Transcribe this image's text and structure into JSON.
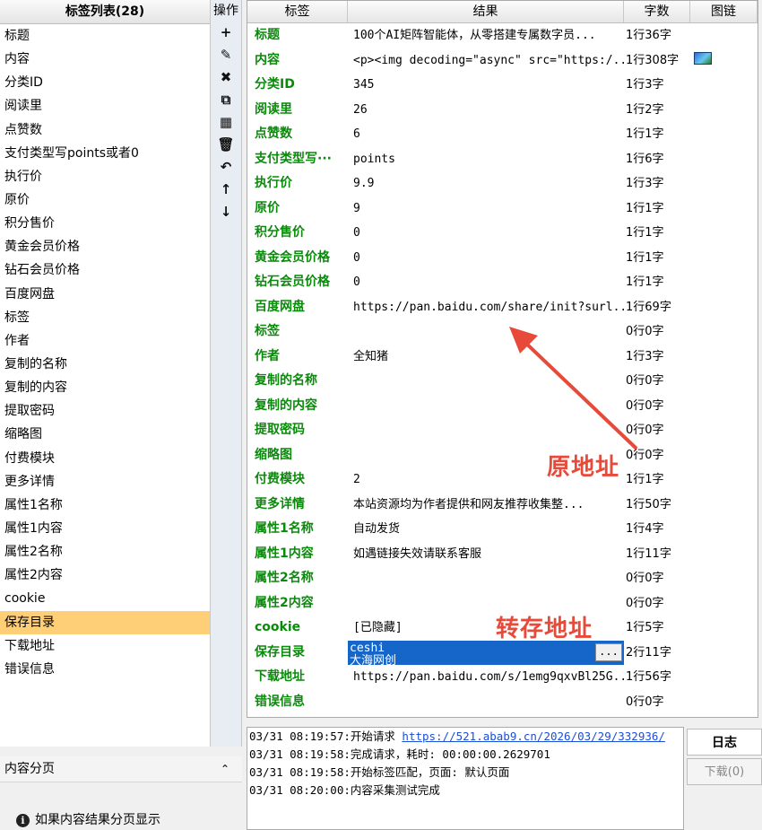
{
  "left_panel": {
    "title": "标签列表(28)",
    "items": [
      "标题",
      "内容",
      "分类ID",
      "阅读里",
      "点赞数",
      "支付类型写points或者0",
      "执行价",
      "原价",
      "积分售价",
      "黄金会员价格",
      "钻石会员价格",
      "百度网盘",
      "标签",
      "作者",
      "复制的名称",
      "复制的内容",
      "提取密码",
      "缩略图",
      "付费模块",
      "更多详情",
      "属性1名称",
      "属性1内容",
      "属性2名称",
      "属性2内容",
      "cookie",
      "保存目录",
      "下载地址",
      "错误信息"
    ],
    "selected_index": 25
  },
  "ops": {
    "title": "操作",
    "buttons": [
      {
        "icon": "plus-icon",
        "glyph": "+"
      },
      {
        "icon": "pencil-icon",
        "glyph": "✎"
      },
      {
        "icon": "close-icon",
        "glyph": "✖"
      },
      {
        "icon": "copy-icon",
        "glyph": "⧉"
      },
      {
        "icon": "paste-icon",
        "glyph": "▦"
      },
      {
        "icon": "trash-icon",
        "glyph": "🗑"
      },
      {
        "icon": "undo-icon",
        "glyph": "↶"
      },
      {
        "icon": "arrow-up-icon",
        "glyph": "↑"
      },
      {
        "icon": "arrow-down-icon",
        "glyph": "↓"
      }
    ]
  },
  "table": {
    "headers": [
      "标签",
      "结果",
      "字数",
      "图链"
    ],
    "rows": [
      {
        "label": "标题",
        "result": "100个AI矩阵智能体，从零搭建专属数字员...",
        "count": "1行36字",
        "img": false
      },
      {
        "label": "内容",
        "result": "<p><img decoding=\"async\" src=\"https:/...",
        "count": "1行308字",
        "img": true
      },
      {
        "label": "分类ID",
        "result": "345",
        "count": "1行3字",
        "img": false
      },
      {
        "label": "阅读里",
        "result": "26",
        "count": "1行2字",
        "img": false
      },
      {
        "label": "点赞数",
        "result": "6",
        "count": "1行1字",
        "img": false
      },
      {
        "label": "支付类型写···",
        "result": "points",
        "count": "1行6字",
        "img": false
      },
      {
        "label": "执行价",
        "result": "9.9",
        "count": "1行3字",
        "img": false
      },
      {
        "label": "原价",
        "result": "9",
        "count": "1行1字",
        "img": false
      },
      {
        "label": "积分售价",
        "result": "0",
        "count": "1行1字",
        "img": false
      },
      {
        "label": "黄金会员价格",
        "result": "0",
        "count": "1行1字",
        "img": false
      },
      {
        "label": "钻石会员价格",
        "result": "0",
        "count": "1行1字",
        "img": false
      },
      {
        "label": "百度网盘",
        "result": "https://pan.baidu.com/share/init?surl...",
        "count": "1行69字",
        "img": false
      },
      {
        "label": "标签",
        "result": "",
        "count": "0行0字",
        "img": false
      },
      {
        "label": "作者",
        "result": "全知猪",
        "count": "1行3字",
        "img": false
      },
      {
        "label": "复制的名称",
        "result": "",
        "count": "0行0字",
        "img": false
      },
      {
        "label": "复制的内容",
        "result": "",
        "count": "0行0字",
        "img": false
      },
      {
        "label": "提取密码",
        "result": "",
        "count": "0行0字",
        "img": false
      },
      {
        "label": "缩略图",
        "result": "",
        "count": "0行0字",
        "img": false
      },
      {
        "label": "付费模块",
        "result": "2",
        "count": "1行1字",
        "img": false
      },
      {
        "label": "更多详情",
        "result": "本站资源均为作者提供和网友推荐收集整...",
        "count": "1行50字",
        "img": false
      },
      {
        "label": "属性1名称",
        "result": "自动发货",
        "count": "1行4字",
        "img": false
      },
      {
        "label": "属性1内容",
        "result": "如遇链接失效请联系客服",
        "count": "1行11字",
        "img": false
      },
      {
        "label": "属性2名称",
        "result": "",
        "count": "0行0字",
        "img": false
      },
      {
        "label": "属性2内容",
        "result": "",
        "count": "0行0字",
        "img": false
      },
      {
        "label": "cookie",
        "result": "[已隐藏]",
        "count": "1行5字",
        "img": false
      },
      {
        "label": "保存目录",
        "result": "",
        "count": "2行11字",
        "img": false,
        "editing": true
      },
      {
        "label": "下载地址",
        "result": "https://pan.baidu.com/s/1emg9qxvBl25G...",
        "count": "1行56字",
        "img": false
      },
      {
        "label": "错误信息",
        "result": "",
        "count": "0行0字",
        "img": false
      }
    ],
    "editor": {
      "line1": "ceshi",
      "line2": "大海网创",
      "button": "..."
    }
  },
  "annotations": {
    "original_address": "原地址",
    "transfer_address": "转存地址",
    "color": "#e84a3a"
  },
  "log": {
    "lines": [
      {
        "text": "03/31 08:19:57:开始请求 ",
        "link": "https://521.abab9.cn/2026/03/29/332936/"
      },
      {
        "text": "03/31 08:19:58:完成请求，耗时: 00:00:00.2629701",
        "link": ""
      },
      {
        "text": "03/31 08:19:58:开始标签匹配，页面: 默认页面",
        "link": ""
      },
      {
        "text": "03/31 08:20:00:内容采集测试完成",
        "link": ""
      }
    ]
  },
  "right_tabs": {
    "log": "日志",
    "download": "下载(0)"
  },
  "bottom_left": {
    "title": "内容分页",
    "chevron": "⌃⌃",
    "info": "如果内容结果分页显示"
  }
}
